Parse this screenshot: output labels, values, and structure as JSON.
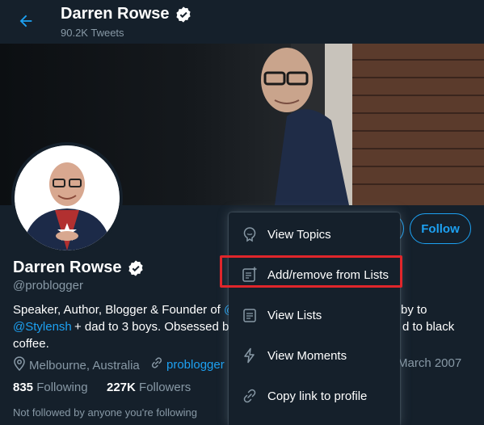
{
  "header": {
    "name": "Darren Rowse",
    "tweets": "90.2K Tweets"
  },
  "profile": {
    "name": "Darren Rowse",
    "handle": "@problogger",
    "bio": {
      "line1_start": "Speaker, Author, Blogger & Founder of",
      "line1_link_frag": "@",
      "line1_end": "by to",
      "line2_link": "@Stylensh",
      "line2_mid": "+ dad to 3 boys. Obsessed by",
      "line2_end": "d to black",
      "line3": "coffee."
    },
    "location": "Melbourne, Australia",
    "website": "problogger",
    "joined": "March 2007",
    "following_count": "835",
    "following_label": "Following",
    "followers_count": "227K",
    "followers_label": "Followers",
    "not_followed": "Not followed by anyone you're following"
  },
  "actions": {
    "follow_label": "Follow"
  },
  "menu": {
    "items": [
      {
        "label": "View Topics",
        "icon": "topic-icon"
      },
      {
        "label": "Add/remove from Lists",
        "icon": "list-add-icon"
      },
      {
        "label": "View Lists",
        "icon": "list-icon"
      },
      {
        "label": "View Moments",
        "icon": "lightning-icon"
      },
      {
        "label": "Copy link to profile",
        "icon": "link-icon"
      }
    ],
    "highlighted_index": 1
  },
  "colors": {
    "background": "#15202b",
    "accent": "#1da1f2",
    "secondary_text": "#8899a6",
    "highlight": "#e0262b"
  }
}
